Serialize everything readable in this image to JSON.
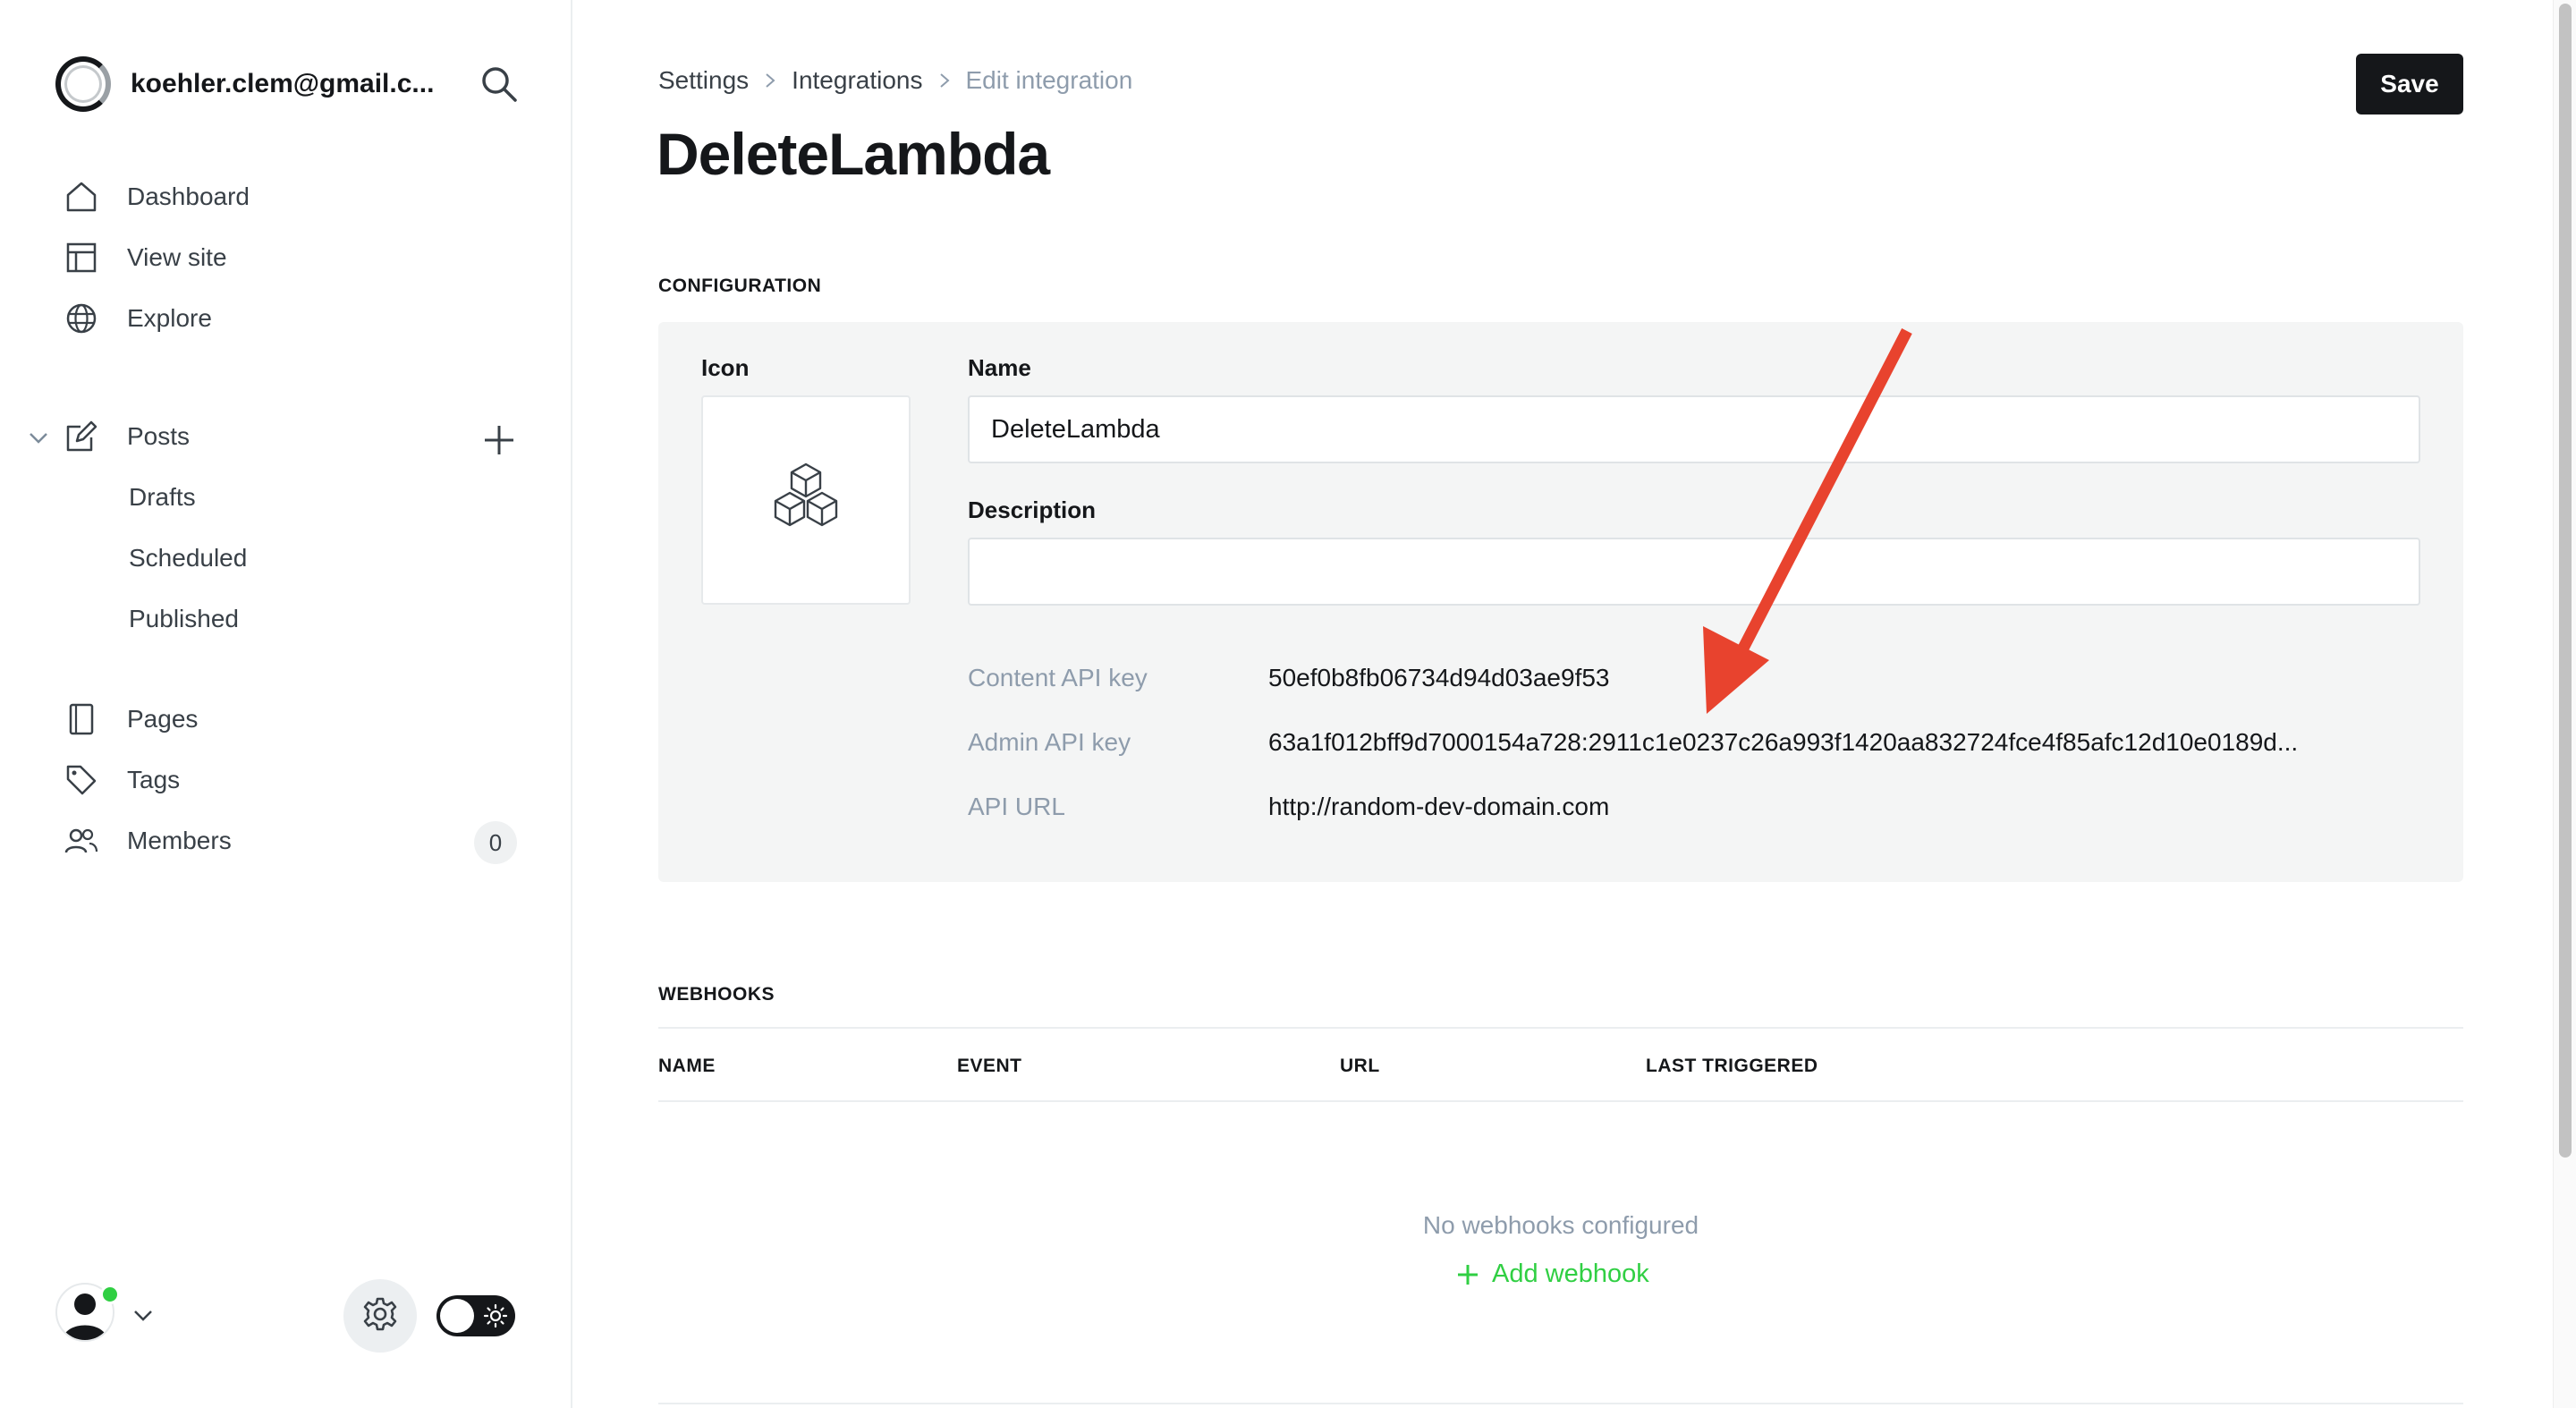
{
  "sidebar": {
    "account_title": "koehler.clem@gmail.c...",
    "nav": {
      "dashboard": "Dashboard",
      "view_site": "View site",
      "explore": "Explore",
      "posts": "Posts",
      "drafts": "Drafts",
      "scheduled": "Scheduled",
      "published": "Published",
      "pages": "Pages",
      "tags": "Tags",
      "members": "Members",
      "members_count": "0"
    }
  },
  "header": {
    "breadcrumb": [
      "Settings",
      "Integrations",
      "Edit integration"
    ],
    "title": "DeleteLambda",
    "save_label": "Save"
  },
  "configuration": {
    "section_label": "CONFIGURATION",
    "icon_label": "Icon",
    "name_label": "Name",
    "name_value": "DeleteLambda",
    "description_label": "Description",
    "description_value": "",
    "content_api_key_label": "Content API key",
    "content_api_key": "50ef0b8fb06734d94d03ae9f53",
    "admin_api_key_label": "Admin API key",
    "admin_api_key": "63a1f012bff9d7000154a728:2911c1e0237c26a993f1420aa832724fce4f85afc12d10e0189d...",
    "api_url_label": "API URL",
    "api_url": "http://random-dev-domain.com"
  },
  "webhooks": {
    "section_label": "WEBHOOKS",
    "columns": [
      "NAME",
      "EVENT",
      "URL",
      "LAST TRIGGERED"
    ],
    "empty_message": "No webhooks configured",
    "add_label": "Add webhook"
  },
  "colors": {
    "accent_green": "#30cf43",
    "annotation_arrow": "#e8432e",
    "dark": "#15171a"
  }
}
